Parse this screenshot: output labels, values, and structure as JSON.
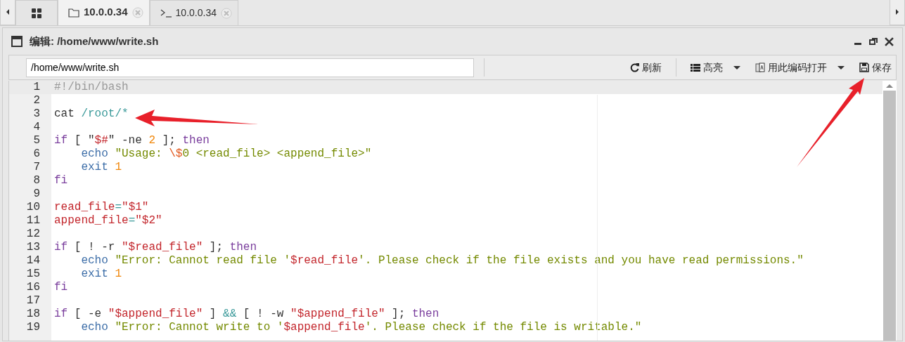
{
  "tabs": [
    {
      "kind": "home",
      "selected": false
    },
    {
      "kind": "files",
      "label": "10.0.0.34",
      "selected": true
    },
    {
      "kind": "terminal",
      "label": "10.0.0.34",
      "selected": false
    }
  ],
  "window": {
    "title": "编辑: /home/www/write.sh"
  },
  "toolbar": {
    "path_value": "/home/www/write.sh",
    "buttons": [
      {
        "kind": "refresh",
        "label": "刷新",
        "dropdown": false
      },
      {
        "kind": "highlight",
        "label": "高亮",
        "dropdown": true
      },
      {
        "kind": "encoding",
        "label": "用此编码打开",
        "dropdown": true
      },
      {
        "kind": "save",
        "label": "保存",
        "dropdown": false
      }
    ]
  },
  "editor": {
    "lines": [
      {
        "number": "1",
        "active": true,
        "tokens": [
          {
            "kind": "comment",
            "text": "#!/bin/bash"
          }
        ]
      },
      {
        "number": "2",
        "active": false
      },
      {
        "number": "3",
        "active": false,
        "tokens": [
          {
            "kind": "plain",
            "text": "cat "
          },
          {
            "kind": "op",
            "text": "/root/*"
          }
        ]
      },
      {
        "number": "4",
        "active": false
      },
      {
        "number": "5",
        "active": false,
        "tokens": [
          {
            "kind": "kw",
            "text": "if"
          },
          {
            "kind": "plain",
            "text": " [ \""
          },
          {
            "kind": "var",
            "text": "$#"
          },
          {
            "kind": "plain",
            "text": "\" -ne "
          },
          {
            "kind": "num",
            "text": "2"
          },
          {
            "kind": "plain",
            "text": " ]; "
          },
          {
            "kind": "kw",
            "text": "then"
          }
        ]
      },
      {
        "number": "6",
        "active": false,
        "tokens": [
          {
            "kind": "builtin",
            "text": "    echo"
          },
          {
            "kind": "str",
            "text": " \"Usage: "
          },
          {
            "kind": "esc",
            "text": "\\$"
          },
          {
            "kind": "str",
            "text": "0 <read_file> <append_file>\""
          }
        ]
      },
      {
        "number": "7",
        "active": false,
        "tokens": [
          {
            "kind": "builtin",
            "text": "    exit"
          },
          {
            "kind": "num",
            "text": " 1"
          }
        ]
      },
      {
        "number": "8",
        "active": false,
        "tokens": [
          {
            "kind": "kw",
            "text": "fi"
          }
        ]
      },
      {
        "number": "9",
        "active": false
      },
      {
        "number": "10",
        "active": false,
        "tokens": [
          {
            "kind": "var",
            "text": "read_file"
          },
          {
            "kind": "op",
            "text": "="
          },
          {
            "kind": "var",
            "text": "\"$1\""
          }
        ]
      },
      {
        "number": "11",
        "active": false,
        "tokens": [
          {
            "kind": "var",
            "text": "append_file"
          },
          {
            "kind": "op",
            "text": "="
          },
          {
            "kind": "var",
            "text": "\"$2\""
          }
        ]
      },
      {
        "number": "12",
        "active": false
      },
      {
        "number": "13",
        "active": false,
        "tokens": [
          {
            "kind": "kw",
            "text": "if"
          },
          {
            "kind": "plain",
            "text": " [ ! -r "
          },
          {
            "kind": "var",
            "text": "\"$read_file\""
          },
          {
            "kind": "plain",
            "text": " ]; "
          },
          {
            "kind": "kw",
            "text": "then"
          }
        ]
      },
      {
        "number": "14",
        "active": false,
        "tokens": [
          {
            "kind": "builtin",
            "text": "    echo"
          },
          {
            "kind": "str",
            "text": " \"Error: Cannot read file '"
          },
          {
            "kind": "var",
            "text": "$read_file"
          },
          {
            "kind": "str",
            "text": "'. Please check if the file exists and you have read permissions.\""
          }
        ]
      },
      {
        "number": "15",
        "active": false,
        "tokens": [
          {
            "kind": "builtin",
            "text": "    exit"
          },
          {
            "kind": "num",
            "text": " 1"
          }
        ]
      },
      {
        "number": "16",
        "active": false,
        "tokens": [
          {
            "kind": "kw",
            "text": "fi"
          }
        ]
      },
      {
        "number": "17",
        "active": false
      },
      {
        "number": "18",
        "active": false,
        "tokens": [
          {
            "kind": "kw",
            "text": "if"
          },
          {
            "kind": "plain",
            "text": " [ -e "
          },
          {
            "kind": "var",
            "text": "\"$append_file\""
          },
          {
            "kind": "plain",
            "text": " ] "
          },
          {
            "kind": "op",
            "text": "&&"
          },
          {
            "kind": "plain",
            "text": " [ ! -w "
          },
          {
            "kind": "var",
            "text": "\"$append_file\""
          },
          {
            "kind": "plain",
            "text": " ]; "
          },
          {
            "kind": "kw",
            "text": "then"
          }
        ]
      },
      {
        "number": "19",
        "active": false,
        "tokens": [
          {
            "kind": "builtin",
            "text": "    echo"
          },
          {
            "kind": "str",
            "text": " \"Error: Cannot write to '"
          },
          {
            "kind": "var",
            "text": "$append_file"
          },
          {
            "kind": "str",
            "text": "'. Please check if the file is writable.\""
          }
        ]
      }
    ]
  }
}
